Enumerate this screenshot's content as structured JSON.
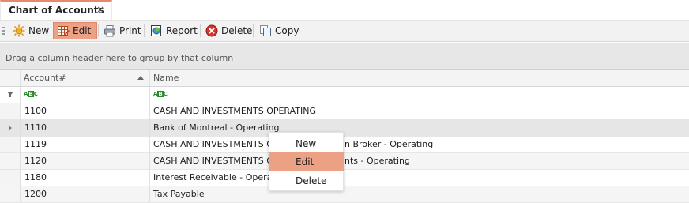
{
  "tab": {
    "title": "Chart of Accounts",
    "close": "×"
  },
  "toolbar": {
    "new_label": "New",
    "edit_label": "Edit",
    "print_label": "Print",
    "report_label": "Report",
    "delete_label": "Delete",
    "copy_label": "Copy"
  },
  "group_panel": {
    "text": "Drag a column header here to group by that column"
  },
  "grid": {
    "columns": [
      "Account#",
      "Name"
    ],
    "filter_icons": [
      "abc-filter-icon",
      "abc-filter-icon"
    ],
    "rows": [
      {
        "account": "1100",
        "name": "CASH AND INVESTMENTS OPERATING"
      },
      {
        "account": "1110",
        "name": "Bank of Montreal - Operating"
      },
      {
        "account": "1119",
        "name": "CASH AND INVESTMENTS OPE",
        "name_tail": "n Broker - Operating"
      },
      {
        "account": "1120",
        "name": "CASH AND INVESTMENTS OPE",
        "name_tail": "nts - Operating"
      },
      {
        "account": "1180",
        "name": "Interest Receivable - Operatin"
      },
      {
        "account": "1200",
        "name": "Tax Payable"
      }
    ]
  },
  "context_menu": {
    "items": [
      "New",
      "Edit",
      "Delete"
    ],
    "highlighted": "Edit"
  },
  "colors": {
    "accent": "#eda184",
    "accent_border": "#dd8768"
  }
}
